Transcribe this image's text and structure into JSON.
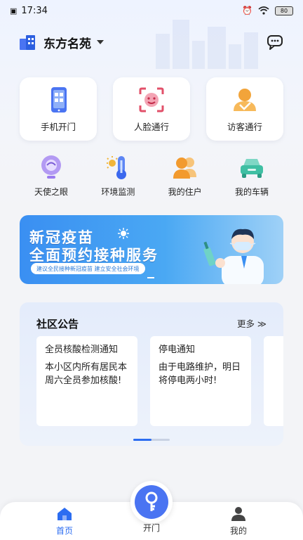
{
  "status_bar": {
    "time": "17:34",
    "battery": "80"
  },
  "header": {
    "community_name": "东方名苑"
  },
  "main_actions": [
    {
      "label": "手机开门",
      "icon": "phone-qr-icon"
    },
    {
      "label": "人脸通行",
      "icon": "face-scan-icon"
    },
    {
      "label": "访客通行",
      "icon": "visitor-icon"
    }
  ],
  "secondary_actions": [
    {
      "label": "天使之眼",
      "icon": "camera-eye-icon"
    },
    {
      "label": "环境监测",
      "icon": "thermometer-icon"
    },
    {
      "label": "我的住户",
      "icon": "residents-icon"
    },
    {
      "label": "我的车辆",
      "icon": "car-icon"
    }
  ],
  "banner": {
    "title_line1": "新冠疫苗",
    "title_line2": "全面预约接种服务",
    "subtitle": "建议全民接种新冠疫苗  建立安全社会环境"
  },
  "notice": {
    "title": "社区公告",
    "more": "更多 ≫",
    "items": [
      {
        "title": "全员核酸检测通知",
        "body": "本小区内所有居民本周六全员参加核酸!"
      },
      {
        "title": "停电通知",
        "body": "由于电路维护，明日将停电两小时!"
      }
    ],
    "page_index": 1,
    "page_count": 2
  },
  "bottom_nav": {
    "home": "首页",
    "open_door": "开门",
    "mine": "我的"
  },
  "colors": {
    "accent": "#2c6df1",
    "banner": "#3a8ff2",
    "open_button": "#4a74f2"
  }
}
